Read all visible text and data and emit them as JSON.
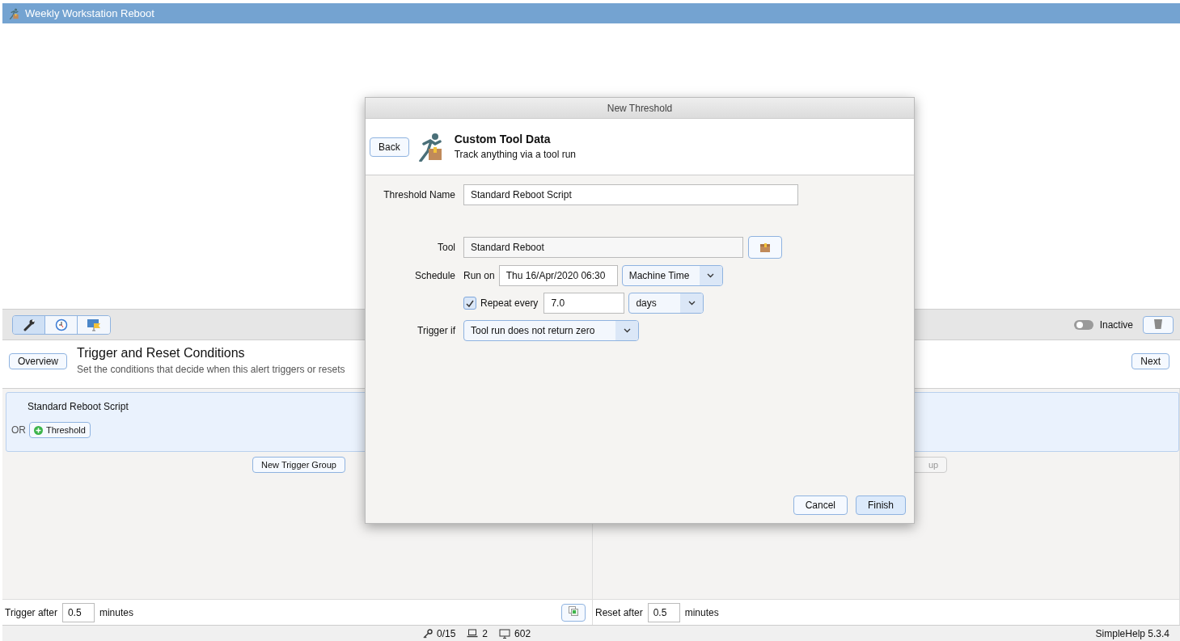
{
  "window": {
    "title": "Weekly Workstation Reboot"
  },
  "toolbar": {
    "tabs": [
      {
        "selected": true
      },
      {
        "selected": false
      },
      {
        "selected": false
      }
    ],
    "toggle": {
      "label": "Inactive",
      "on": false
    }
  },
  "header": {
    "back_button": "Overview",
    "title": "Trigger and Reset Conditions",
    "subtitle": "Set the conditions that decide when this alert triggers or resets",
    "next_button": "Next"
  },
  "trigger_groups": [
    {
      "name": "Standard Reboot Script",
      "connector": "OR",
      "add_button": "Threshold"
    }
  ],
  "new_trigger_group_button": "New Trigger Group",
  "reset_group_button": "up",
  "trigger_after": {
    "label": "Trigger after",
    "value": "0.5",
    "unit": "minutes"
  },
  "reset_after": {
    "label": "Reset after",
    "value": "0.5",
    "unit": "minutes"
  },
  "status_bar": {
    "items": [
      {
        "kind": "key",
        "text": "0/15"
      },
      {
        "kind": "laptop",
        "text": "2"
      },
      {
        "kind": "monitor",
        "text": "602"
      }
    ],
    "version": "SimpleHelp 5.3.4"
  },
  "dialog": {
    "title": "New Threshold",
    "back": "Back",
    "heading": "Custom Tool Data",
    "subheading": "Track anything via a tool run",
    "threshold_name": {
      "label": "Threshold Name",
      "value": "Standard Reboot Script"
    },
    "tool": {
      "label": "Tool",
      "value": "Standard Reboot"
    },
    "schedule": {
      "label": "Schedule",
      "run_on_label": "Run on",
      "run_on": "Thu 16/Apr/2020 06:30",
      "timezone": "Machine Time",
      "repeat_label": "Repeat every",
      "repeat_checked": true,
      "repeat_value": "7.0",
      "repeat_unit": "days"
    },
    "trigger_if": {
      "label": "Trigger if",
      "value": "Tool run does not return zero"
    },
    "buttons": [
      {
        "label": "Cancel",
        "primary": false
      },
      {
        "label": "Finish",
        "primary": true
      }
    ]
  }
}
